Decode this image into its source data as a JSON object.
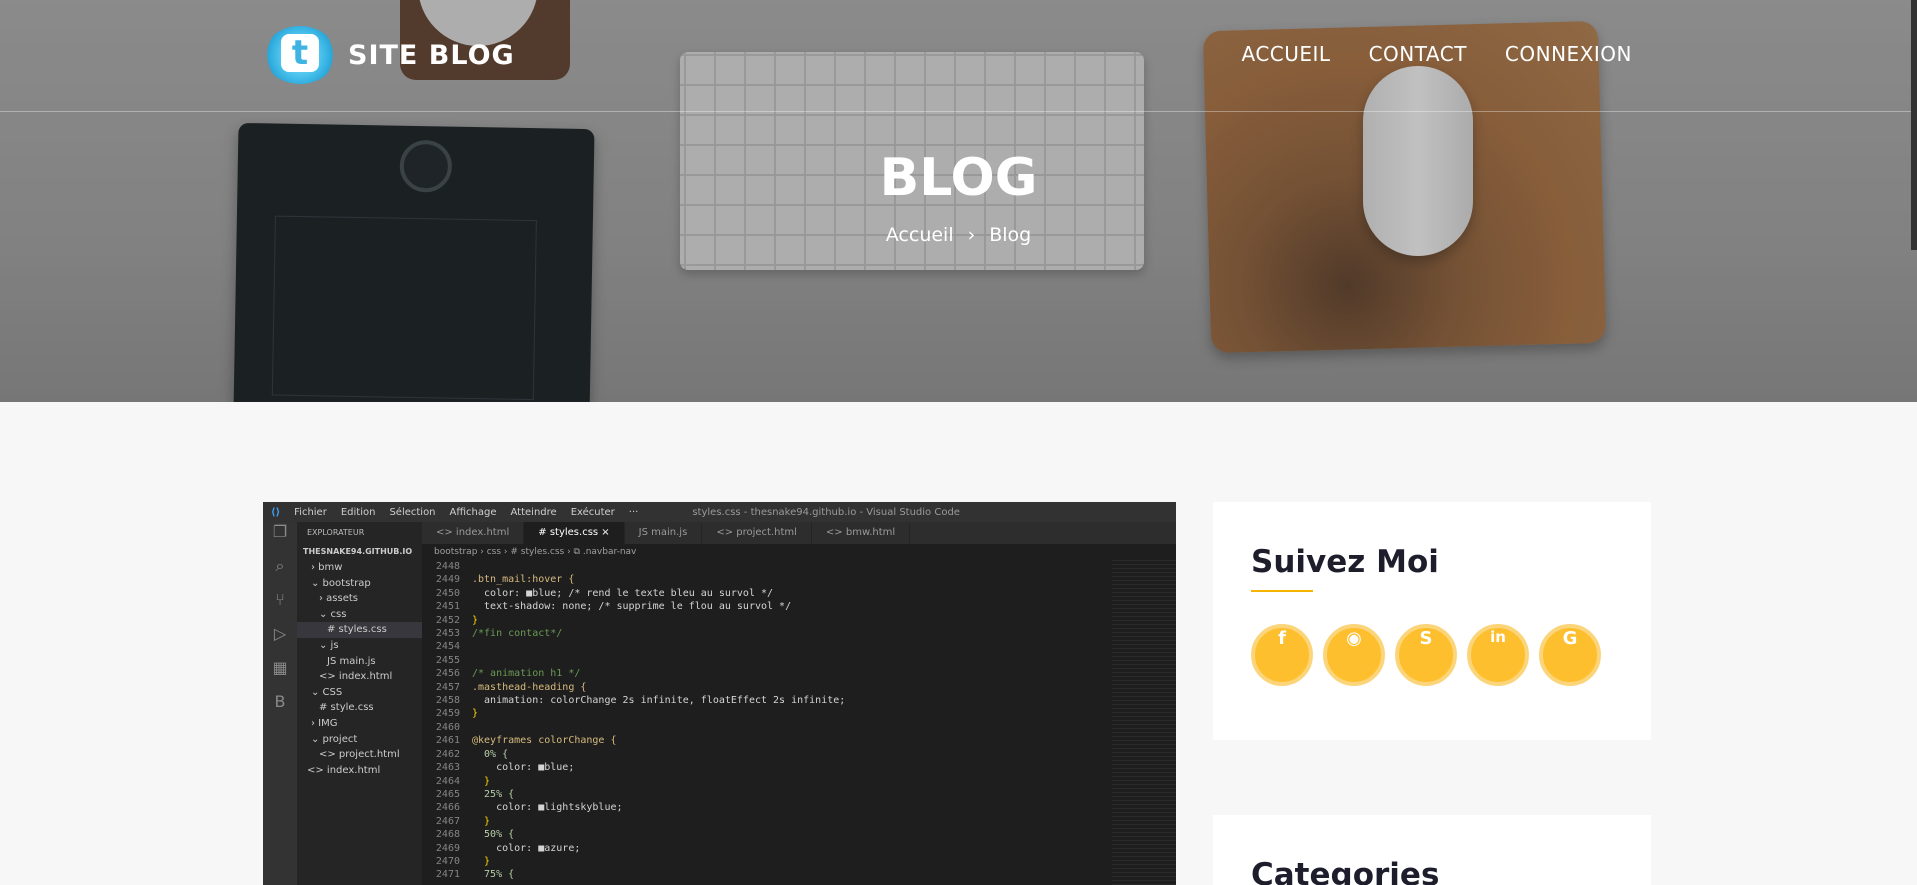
{
  "brand": {
    "name": "SITE BLOG",
    "logo_icon": "twitter-bird-icon"
  },
  "nav": {
    "items": [
      "ACCUEIL",
      "CONTACT",
      "CONNEXION"
    ]
  },
  "hero": {
    "title": "BLOG",
    "breadcrumb": {
      "home": "Accueil",
      "separator": "›",
      "current": "Blog"
    }
  },
  "post_image": {
    "title_bar": {
      "menus": [
        "Fichier",
        "Edition",
        "Sélection",
        "Affichage",
        "Atteindre",
        "Exécuter",
        "···"
      ],
      "window_title": "styles.css - thesnake94.github.io - Visual Studio Code"
    },
    "explorer": {
      "header": "EXPLORATEUR",
      "root": "THESNAKE94.GITHUB.IO",
      "items": [
        "› bmw",
        "⌄ bootstrap",
        "› assets",
        "⌄ css",
        "# styles.css",
        "⌄ js",
        "JS main.js",
        "<> index.html",
        "⌄ CSS",
        "# style.css",
        "› IMG",
        "⌄ project",
        "<> project.html",
        "<> index.html"
      ]
    },
    "tabs": [
      "<> index.html",
      "# styles.css ×",
      "JS main.js",
      "<> project.html",
      "<> bmw.html"
    ],
    "path": "bootstrap › css › # styles.css › ⧉ .navbar-nav",
    "code_lines": [
      {
        "n": "2448",
        "t": ""
      },
      {
        "n": "2449",
        "t": ".btn_mail:hover {"
      },
      {
        "n": "2450",
        "t": "  color: ■blue; /* rend le texte bleu au survol */"
      },
      {
        "n": "2451",
        "t": "  text-shadow: none; /* supprime le flou au survol */"
      },
      {
        "n": "2452",
        "t": "}"
      },
      {
        "n": "2453",
        "t": "/*fin contact*/"
      },
      {
        "n": "2454",
        "t": ""
      },
      {
        "n": "2455",
        "t": ""
      },
      {
        "n": "2456",
        "t": "/* animation h1 */"
      },
      {
        "n": "2457",
        "t": ".masthead-heading {"
      },
      {
        "n": "2458",
        "t": "  animation: colorChange 2s infinite, floatEffect 2s infinite;"
      },
      {
        "n": "2459",
        "t": "}"
      },
      {
        "n": "2460",
        "t": ""
      },
      {
        "n": "2461",
        "t": "@keyframes colorChange {"
      },
      {
        "n": "2462",
        "t": "  0% {"
      },
      {
        "n": "2463",
        "t": "    color: ■blue;"
      },
      {
        "n": "2464",
        "t": "  }"
      },
      {
        "n": "2465",
        "t": "  25% {"
      },
      {
        "n": "2466",
        "t": "    color: ■lightskyblue;"
      },
      {
        "n": "2467",
        "t": "  }"
      },
      {
        "n": "2468",
        "t": "  50% {"
      },
      {
        "n": "2469",
        "t": "    color: ■azure;"
      },
      {
        "n": "2470",
        "t": "  }"
      },
      {
        "n": "2471",
        "t": "  75% {"
      }
    ]
  },
  "sidebar": {
    "follow_title": "Suivez Moi",
    "socials": [
      {
        "name": "facebook-icon",
        "glyph": "f"
      },
      {
        "name": "github-icon",
        "glyph": "◉"
      },
      {
        "name": "skype-icon",
        "glyph": "S"
      },
      {
        "name": "linkedin-icon",
        "glyph": "in"
      },
      {
        "name": "google-icon",
        "glyph": "G"
      }
    ],
    "categories_title": "Categories"
  },
  "colors": {
    "accent": "#fdbf2d",
    "accent_underline": "#f4b400",
    "page_bg": "#f7f7f7"
  }
}
